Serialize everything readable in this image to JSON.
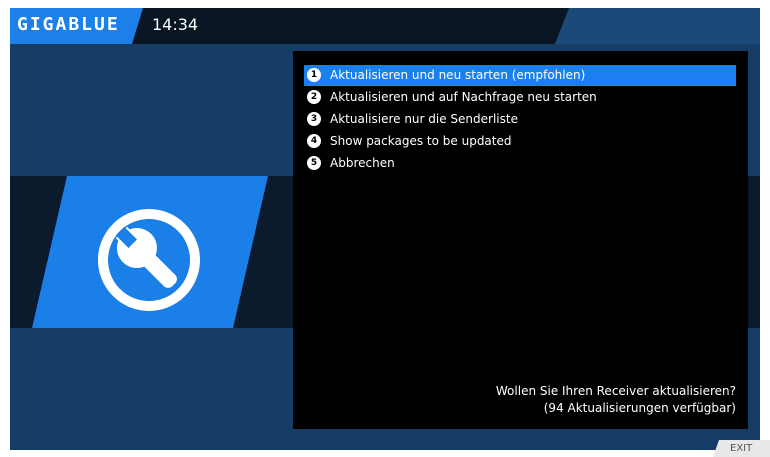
{
  "header": {
    "logo_text": "GIGABLUE",
    "time": "14:34"
  },
  "menu": {
    "items": [
      {
        "number": "1",
        "label": "Aktualisieren und neu starten (empfohlen)",
        "selected": true
      },
      {
        "number": "2",
        "label": "Aktualisieren und auf Nachfrage neu starten",
        "selected": false
      },
      {
        "number": "3",
        "label": "Aktualisiere nur die Senderliste",
        "selected": false
      },
      {
        "number": "4",
        "label": "Show packages to be updated",
        "selected": false
      },
      {
        "number": "5",
        "label": "Abbrechen",
        "selected": false
      }
    ]
  },
  "question": {
    "line1": "Wollen Sie Ihren Receiver aktualisieren?",
    "line2": "(94 Aktualisierungen verfügbar)"
  },
  "footer": {
    "exit_label": "EXIT"
  },
  "colors": {
    "accent": "#1c7ff0",
    "background": "#163d66",
    "dark_band": "#0b1a2c",
    "menu_bg": "#000000"
  },
  "icons": {
    "main": "wrench-icon"
  }
}
